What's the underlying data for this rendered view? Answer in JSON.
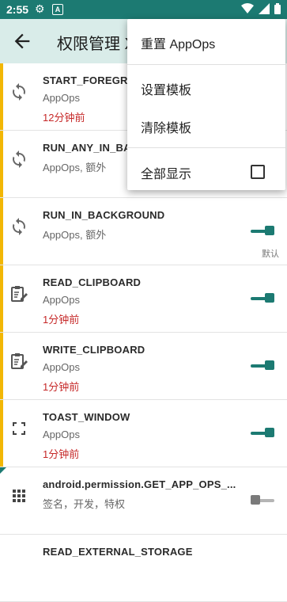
{
  "status_bar": {
    "time": "2:55"
  },
  "app_bar": {
    "title": "权限管理 X"
  },
  "menu": {
    "items": [
      {
        "label": "重置 AppOps"
      },
      {
        "label": "设置模板"
      },
      {
        "label": "清除模板"
      },
      {
        "label": "全部显示",
        "checked": false
      }
    ]
  },
  "list": [
    {
      "name": "START_FOREGROUND",
      "sub": "AppOps",
      "time": "12分钟前",
      "icon": "sync-icon",
      "enabled": true
    },
    {
      "name": "RUN_ANY_IN_BACKGROUND",
      "sub": "AppOps, 额外",
      "time": "",
      "icon": "sync-icon",
      "enabled": true
    },
    {
      "name": "RUN_IN_BACKGROUND",
      "sub": "AppOps, 额外",
      "time": "",
      "icon": "sync-icon",
      "enabled": true,
      "badge": "默认"
    },
    {
      "name": "READ_CLIPBOARD",
      "sub": "AppOps",
      "time": "1分钟前",
      "icon": "clipboard-edit-icon",
      "enabled": true
    },
    {
      "name": "WRITE_CLIPBOARD",
      "sub": "AppOps",
      "time": "1分钟前",
      "icon": "clipboard-edit-icon",
      "enabled": true
    },
    {
      "name": "TOAST_WINDOW",
      "sub": "AppOps",
      "time": "1分钟前",
      "icon": "fullscreen-icon",
      "enabled": true
    },
    {
      "name": "android.permission.GET_APP_OPS_...",
      "sub": "签名，开发，特权",
      "time": "",
      "icon": "grid-icon",
      "enabled": false
    },
    {
      "name": "READ_EXTERNAL_STORAGE",
      "sub": "",
      "time": "",
      "icon": "",
      "enabled": true
    }
  ],
  "colors": {
    "accent": "#1c7a72",
    "warning_bar": "#f2b705",
    "time_text": "#c62828",
    "app_bar_bg": "#d9ece9"
  }
}
